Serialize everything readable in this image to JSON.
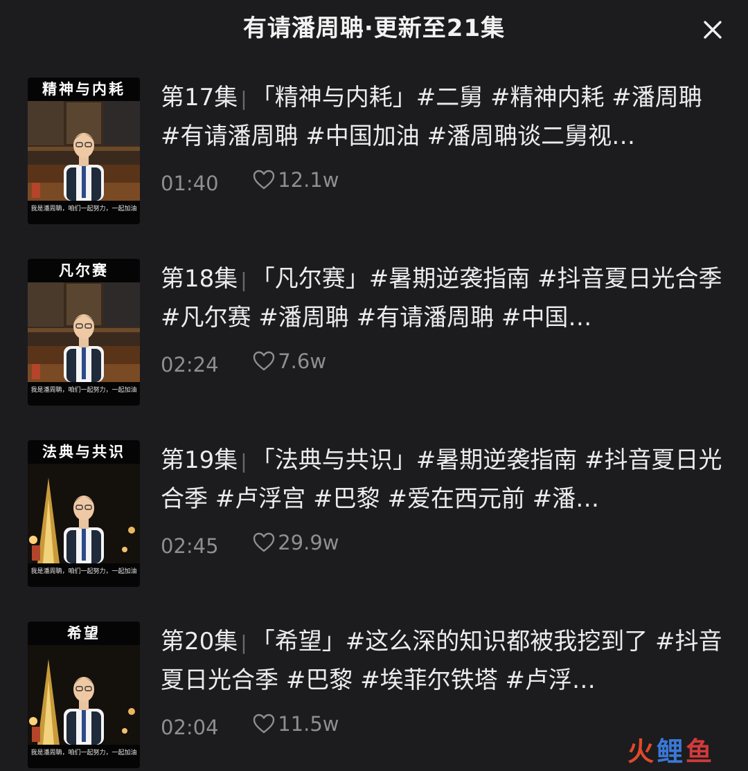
{
  "header": {
    "title": "有请潘周聃·更新至21集",
    "close_icon": "close-icon"
  },
  "episodes": [
    {
      "thumb_label": "精神与内耗",
      "thumb_caption": "我是潘周聃，咱们一起努力，一起加油",
      "thumb_scene": "library",
      "episode_no": "第17集",
      "title": "「精神与内耗」#二舅 #精神内耗 #潘周聃 #有请潘周聃 #中国加油 #潘周聃谈二舅视…",
      "duration": "01:40",
      "likes": "12.1w"
    },
    {
      "thumb_label": "凡尔赛",
      "thumb_caption": "我是潘周聃，咱们一起努力，一起加油",
      "thumb_scene": "library",
      "episode_no": "第18集",
      "title": "「凡尔赛」#暑期逆袭指南 #抖音夏日光合季 #凡尔赛 #潘周聃 #有请潘周聃 #中国…",
      "duration": "02:24",
      "likes": "7.6w"
    },
    {
      "thumb_label": "法典与共识",
      "thumb_caption": "我是潘周聃，咱们一起努力，一起加油",
      "thumb_scene": "night",
      "episode_no": "第19集",
      "title": "「法典与共识」#暑期逆袭指南 #抖音夏日光合季 #卢浮宫 #巴黎 #爱在西元前 #潘…",
      "duration": "02:45",
      "likes": "29.9w"
    },
    {
      "thumb_label": "希望",
      "thumb_caption": "我是潘周聃，咱们一起努力，一起加油",
      "thumb_scene": "night",
      "episode_no": "第20集",
      "title": "「希望」#这么深的知识都被我挖到了 #抖音夏日光合季 #巴黎 #埃菲尔铁塔 #卢浮…",
      "duration": "02:04",
      "likes": "11.5w"
    }
  ],
  "colors": {
    "background": "#1c1c1e",
    "text_primary": "#ececec",
    "text_secondary": "#8e8e93"
  },
  "watermark": {
    "part1": "火",
    "part2": "鲤",
    "part3": "鱼"
  }
}
